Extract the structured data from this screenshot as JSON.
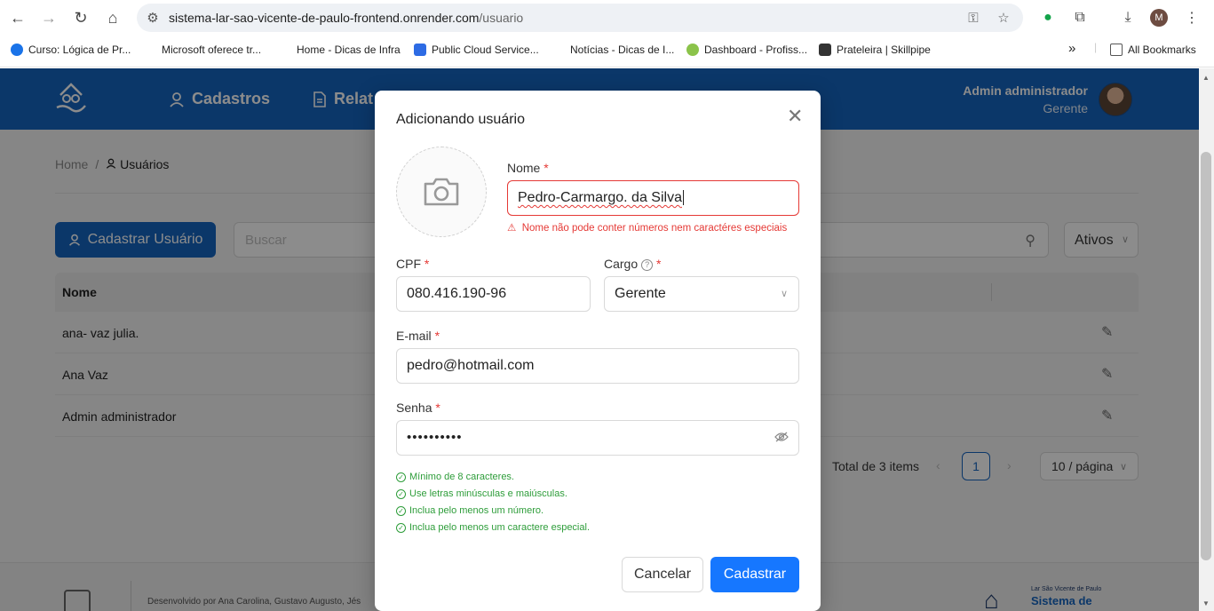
{
  "browser": {
    "url_host": "sistema-lar-sao-vicente-de-paulo-frontend.onrender.com",
    "url_path": "/usuario",
    "profile_initial": "M",
    "bookmarks": [
      {
        "label": "Curso: Lógica de Pr...",
        "color": "#1a73e8"
      },
      {
        "label": "Microsoft oferece tr...",
        "color": ""
      },
      {
        "label": "Home - Dicas de Infra",
        "color": ""
      },
      {
        "label": "Public Cloud Service...",
        "color": "#2d6be4"
      },
      {
        "label": "Notícias - Dicas de I...",
        "color": ""
      },
      {
        "label": "Dashboard - Profiss...",
        "color": "#8bc34a"
      },
      {
        "label": "Prateleira | Skillpipe",
        "color": "#333333"
      }
    ],
    "overflow": "»",
    "all_bookmarks": "All Bookmarks"
  },
  "app": {
    "menu": {
      "cadastros": "Cadastros",
      "relatorios": "Relat"
    },
    "user": {
      "name": "Admin administrador",
      "role": "Gerente"
    },
    "breadcrumb": {
      "home": "Home",
      "sep": "/",
      "current": "Usuários"
    },
    "actions": {
      "add_user": "Cadastrar Usuário",
      "search_placeholder": "Buscar",
      "status_filter": "Ativos"
    },
    "table": {
      "header_name": "Nome",
      "rows": [
        {
          "name": "ana- vaz julia."
        },
        {
          "name": "Ana Vaz"
        },
        {
          "name": "Admin administrador"
        }
      ]
    },
    "pagination": {
      "total": "Total de 3 items",
      "page": "1",
      "page_size": "10 / página"
    },
    "footer": {
      "developed_by": "Desenvolvido por Ana Carolina, Gustavo Augusto, Jés",
      "brand_small": "Lar São Vicente de Paulo",
      "brand": "Sistema de"
    }
  },
  "modal": {
    "title": "Adicionando usuário",
    "fields": {
      "nome": {
        "label": "Nome",
        "value": "Pedro-Carmargo. da Silva",
        "error": "Nome não pode conter números nem caractéres especiais"
      },
      "cpf": {
        "label": "CPF",
        "value": "080.416.190-96"
      },
      "cargo": {
        "label": "Cargo",
        "value": "Gerente"
      },
      "email": {
        "label": "E-mail",
        "value": "pedro@hotmail.com"
      },
      "senha": {
        "label": "Senha",
        "value": "••••••••••"
      }
    },
    "password_rules": [
      "Mínimo de 8 caracteres.",
      "Use letras minúsculas e maiúsculas.",
      "Inclua pelo menos um número.",
      "Inclua pelo menos um caractere especial."
    ],
    "buttons": {
      "cancel": "Cancelar",
      "submit": "Cadastrar"
    }
  },
  "colors": {
    "primary": "#1565c0",
    "submit": "#1677ff",
    "error": "#e53935",
    "success": "#2e9d3a"
  }
}
